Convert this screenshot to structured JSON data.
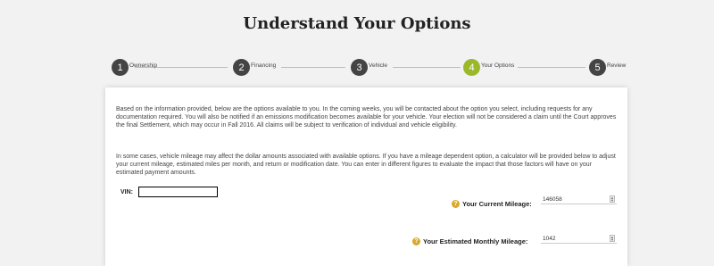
{
  "page": {
    "title": "Understand Your Options"
  },
  "steps": [
    {
      "number": "1",
      "label": "Ownership"
    },
    {
      "number": "2",
      "label": "Financing"
    },
    {
      "number": "3",
      "label": "Vehicle"
    },
    {
      "number": "4",
      "label": "Your Options"
    },
    {
      "number": "5",
      "label": "Review"
    }
  ],
  "active_step": 4,
  "colors": {
    "active": "#9bb82a",
    "inactive": "#444444",
    "help": "#d9a82e"
  },
  "intro": {
    "paragraph1": "Based on the information provided, below are the options available to you. In the coming weeks, you will be contacted about the option you select, including requests for any documentation required.  You will also be notified if an emissions modification becomes available for your vehicle. Your election will not be considered a claim until the Court approves the final Settlement, which may occur in Fall 2016. All claims will be subject to verification of individual and vehicle eligibility.",
    "paragraph2": "In some cases, vehicle mileage may affect the dollar amounts associated with available options. If you have a  mileage dependent option, a calculator will be provided below to adjust your current mileage, estimated miles per month, and return or modification date. You can enter in different figures to evaluate the impact that those factors will have on your estimated payment amounts."
  },
  "vin": {
    "label": "VIN:",
    "value": ""
  },
  "mileage": {
    "current_label": "Your Current Mileage:",
    "current_value": "146058",
    "monthly_label": "Your Estimated Monthly Mileage:",
    "monthly_value": "1042"
  },
  "icons": {
    "help": "question-circle-icon",
    "spinner": "spinner-arrows-icon"
  }
}
